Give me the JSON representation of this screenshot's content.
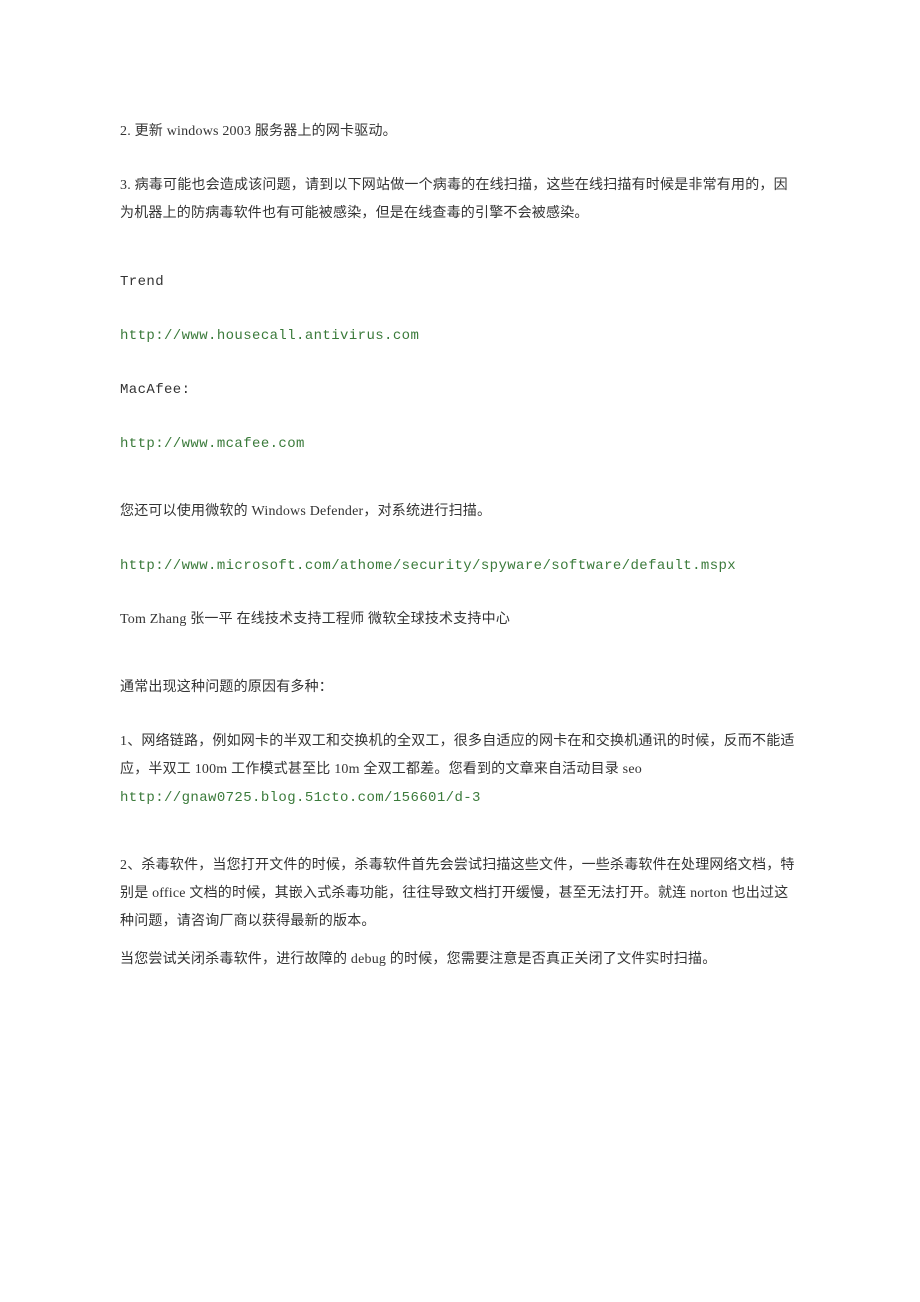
{
  "lines": {
    "p1": "2. 更新 windows 2003 服务器上的网卡驱动。",
    "p2": "3. 病毒可能也会造成该问题，请到以下网站做一个病毒的在线扫描，这些在线扫描有时候是非常有用的，因为机器上的防病毒软件也有可能被感染，但是在线查毒的引擎不会被感染。",
    "p3": "Trend",
    "p4": "http://www.housecall.antivirus.com",
    "p5": "MacAfee:",
    "p6": "http://www.mcafee.com",
    "p7": "您还可以使用微软的 Windows Defender，对系统进行扫描。",
    "p8": "http://www.microsoft.com/athome/security/spyware/software/default.mspx",
    "p9": "Tom Zhang 张一平 在线技术支持工程师 微软全球技术支持中心",
    "p10": "通常出现这种问题的原因有多种：",
    "p11_pre": "1、网络链路，例如网卡的半双工和交换机的全双工，很多自适应的网卡在和交换机通讯的时候，反而不能适应，半双工 100m 工作模式甚至比 10m 全双工都差。您看到的文章来自活动目录 seo ",
    "p11_link": "http://gnaw0725.blog.51cto.com/156601/d-3",
    "p12": "2、杀毒软件，当您打开文件的时候，杀毒软件首先会尝试扫描这些文件，一些杀毒软件在处理网络文档，特别是 office 文档的时候，其嵌入式杀毒功能，往往导致文档打开缓慢，甚至无法打开。就连 norton 也出过这种问题，请咨询厂商以获得最新的版本。",
    "p13": "当您尝试关闭杀毒软件，进行故障的 debug 的时候，您需要注意是否真正关闭了文件实时扫描。"
  }
}
